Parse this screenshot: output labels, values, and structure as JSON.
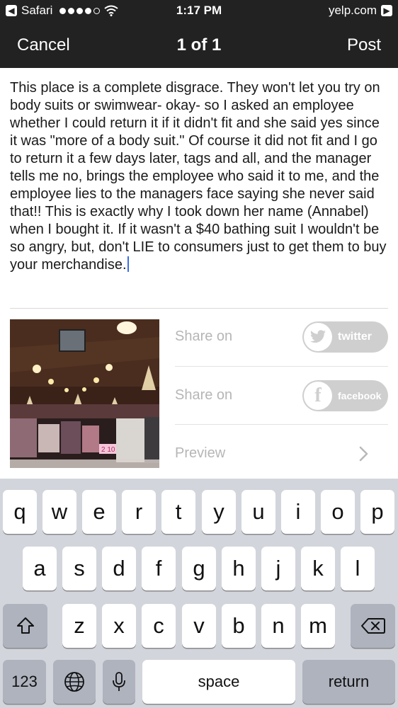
{
  "status_bar": {
    "back_app": "Safari",
    "signal_dots_filled": 4,
    "signal_dots_total": 5,
    "time": "1:17 PM",
    "domain": "yelp.com"
  },
  "nav": {
    "cancel": "Cancel",
    "title": "1 of 1",
    "post": "Post"
  },
  "review": {
    "text": "This place is a complete disgrace. They won't let you try on body suits or swimwear- okay- so I asked an employee whether I could return it if it didn't fit and she said yes since it was \"more of a body suit.\" Of course it did not fit and I go to return it a few days later, tags and all, and the manager tells me no, brings the employee who said it to me, and the employee lies to the managers face saying she never said that!! This is exactly why I took down her name (Annabel) when I bought it. If it wasn't a $40 bathing suit I wouldn't be so angry, but, don't LIE to consumers just to get them to buy your merchandise."
  },
  "share": {
    "twitter_label": "Share on",
    "twitter_button": "twitter",
    "facebook_label": "Share on",
    "facebook_button": "facebook",
    "preview_label": "Preview"
  },
  "photo": {
    "sign_text": "2 10"
  },
  "keyboard": {
    "row1": [
      "q",
      "w",
      "e",
      "r",
      "t",
      "y",
      "u",
      "i",
      "o",
      "p"
    ],
    "row2": [
      "a",
      "s",
      "d",
      "f",
      "g",
      "h",
      "j",
      "k",
      "l"
    ],
    "row3": [
      "z",
      "x",
      "c",
      "v",
      "b",
      "n",
      "m"
    ],
    "numbers": "123",
    "space": "space",
    "return": "return"
  },
  "colors": {
    "bar_background": "#222222",
    "caret": "#3b6fe0",
    "pill": "#cfcfcf",
    "keyboard_background": "#d2d5db"
  }
}
